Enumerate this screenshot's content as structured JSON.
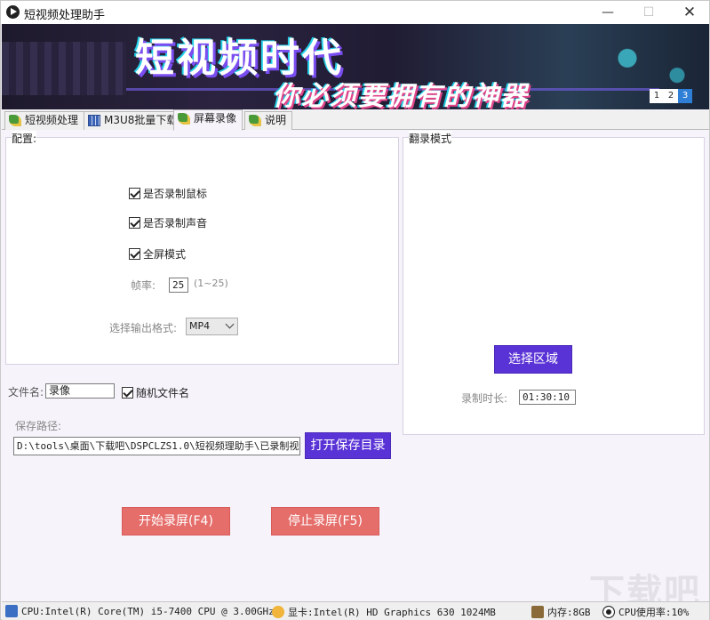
{
  "window": {
    "title": "短视频处理助手"
  },
  "banner": {
    "title": "短视频时代",
    "subtitle": "你必须要拥有的神器",
    "pages": [
      "1",
      "2",
      "3"
    ]
  },
  "tabs": [
    {
      "label": "短视频处理",
      "icon": "leaf-icon"
    },
    {
      "label": "M3U8批量下载",
      "icon": "grid-icon"
    },
    {
      "label": "屏幕录像",
      "icon": "leaf-icon",
      "active": true
    },
    {
      "label": "说明",
      "icon": "leaf-icon"
    }
  ],
  "config": {
    "label": "配置:",
    "record_mouse": "是否录制鼠标",
    "record_audio": "是否录制声音",
    "fullscreen": "全屏模式",
    "fps_label": "帧率:",
    "fps_value": "25",
    "fps_range": "(1~25)",
    "format_label": "选择输出格式:",
    "format_value": "MP4"
  },
  "file": {
    "name_label": "文件名:",
    "name_value": "录像",
    "random_name": "随机文件名",
    "path_label": "保存路径:",
    "path_value": "D:\\tools\\桌面\\下载吧\\DSPCLZS1.0\\短视频理助手\\已录制视频",
    "open_dir_button": "打开保存目录"
  },
  "record_mode": {
    "label": "翻录模式",
    "select_region_button": "选择区域",
    "duration_label": "录制时长:",
    "duration_value": "01:30:10"
  },
  "actions": {
    "start": "开始录屏(F4)",
    "stop": "停止录屏(F5)"
  },
  "status": {
    "cpu": "CPU:Intel(R) Core(TM) i5-7400 CPU @ 3.00GHz",
    "gpu": "显卡:Intel(R) HD Graphics 630   1024MB",
    "memory": "内存:8GB",
    "cpu_usage": "CPU使用率:10%"
  },
  "watermark": "下载吧",
  "colors": {
    "accent": "#5a33d6",
    "action": "#e56e6b",
    "pager_active": "#2f7fd6"
  }
}
